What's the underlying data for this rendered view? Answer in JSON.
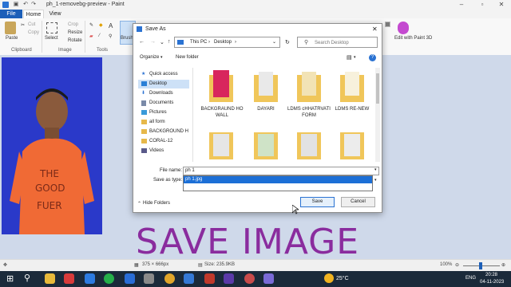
{
  "window": {
    "title": "ph_1-removebg-preview - Paint"
  },
  "menu": {
    "file": "File",
    "home": "Home",
    "view": "View"
  },
  "ribbon": {
    "paste": "Paste",
    "cut": "Cut",
    "copy": "Copy",
    "select": "Select",
    "crop": "Crop",
    "resize": "Resize",
    "rotate": "Rotate",
    "brushes": "Brushes",
    "edit3d": "Edit with Paint 3D",
    "groups": {
      "clipboard": "Clipboard",
      "image": "Image",
      "tools": "Tools"
    }
  },
  "overlay_text": "SAVE IMAGE",
  "status": {
    "dimensions": "375 × 666px",
    "size": "Size: 235.9KB",
    "zoom": "100%"
  },
  "taskbar": {
    "weather": "25°C",
    "lang": "ENG",
    "time": "20:28",
    "date": "04-11-2023"
  },
  "dialog": {
    "title": "Save As",
    "breadcrumb": [
      "This PC",
      "Desktop"
    ],
    "search_placeholder": "Search Desktop",
    "organize": "Organize",
    "new_folder": "New folder",
    "nav": [
      {
        "label": "Quick access"
      },
      {
        "label": "Desktop"
      },
      {
        "label": "Downloads"
      },
      {
        "label": "Documents"
      },
      {
        "label": "Pictures"
      },
      {
        "label": "all form"
      },
      {
        "label": "BACKGROUND H"
      },
      {
        "label": "CORAL-12"
      },
      {
        "label": "Videos"
      }
    ],
    "files": [
      {
        "name": "BACKGRAUND HO WALL"
      },
      {
        "name": "DAYARI"
      },
      {
        "name": "LDMS cHHATRVATI FORM"
      },
      {
        "name": "LDMS RE-NEW"
      }
    ],
    "file_name_label": "File name:",
    "file_name_value": "ph 1",
    "save_as_type_label": "Save as type:",
    "suggestion": "ph 1.jpg",
    "hide_folders": "Hide Folders",
    "save": "Save",
    "cancel": "Cancel"
  }
}
